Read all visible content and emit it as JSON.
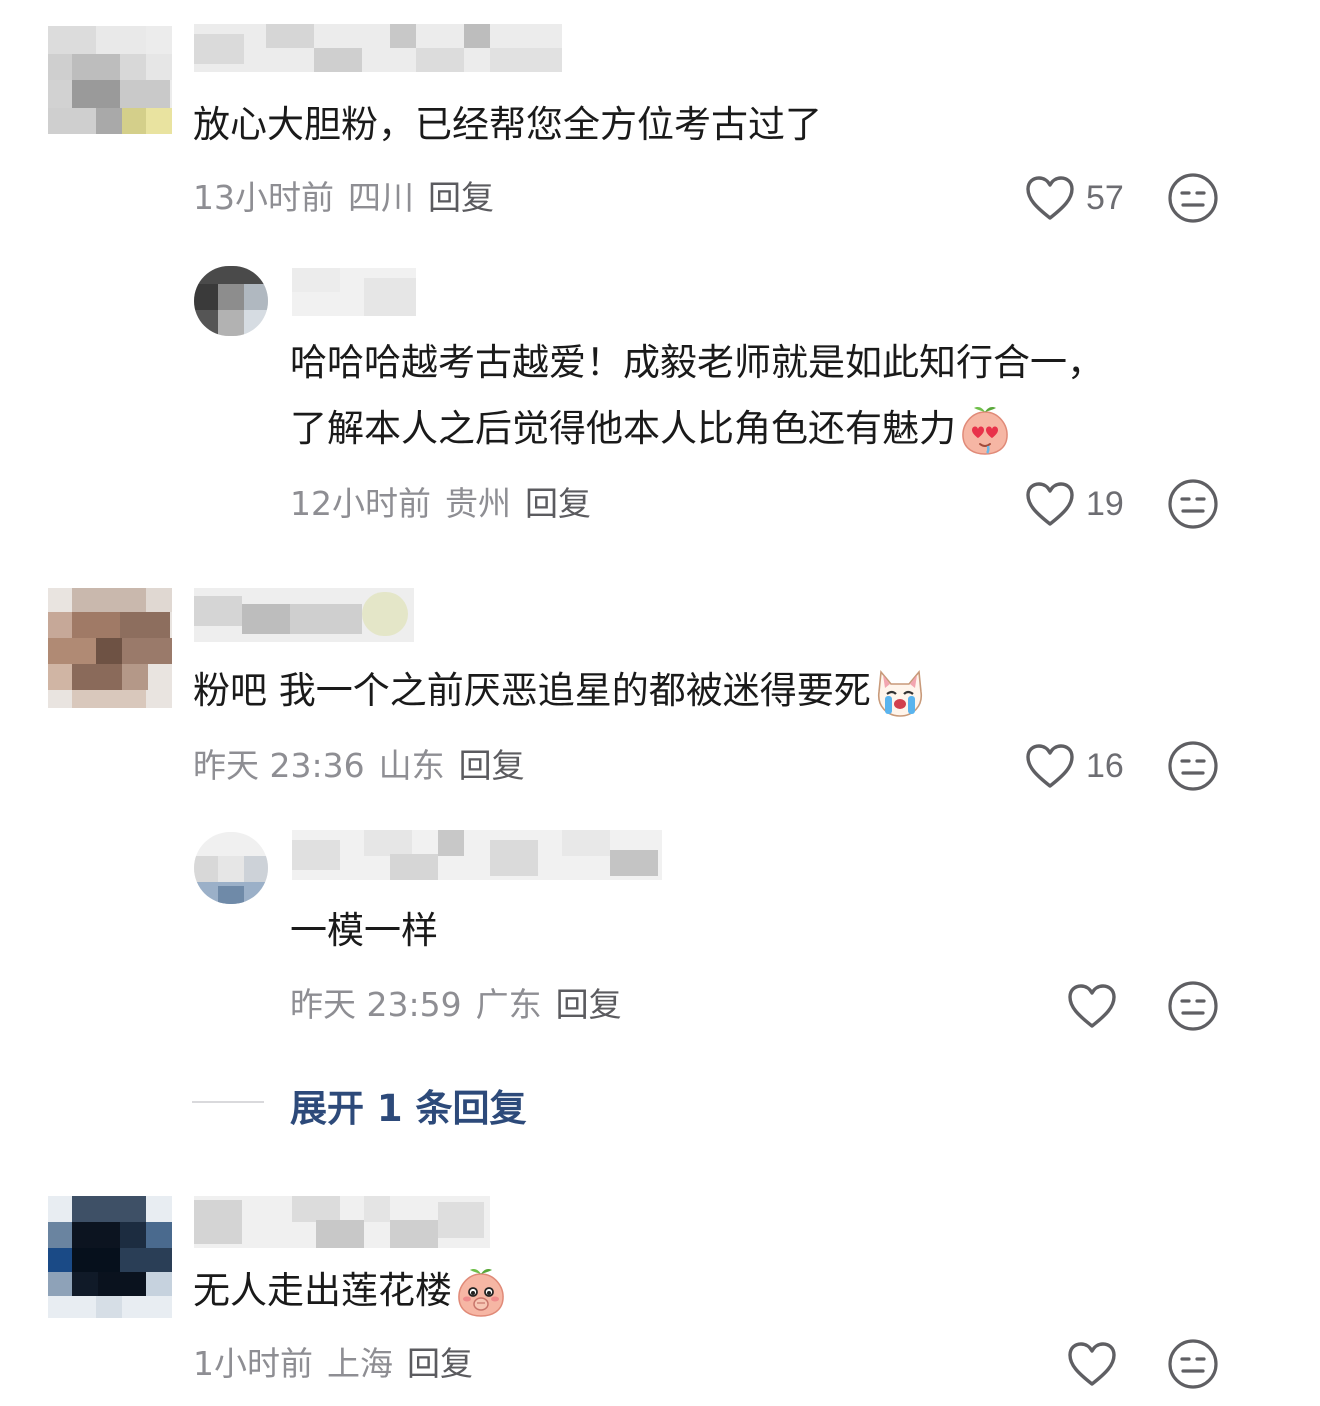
{
  "comments": [
    {
      "text": "放心大胆粉，已经帮您全方位考古过了",
      "time": "13小时前",
      "location": "四川",
      "reply_label": "回复",
      "likes": "57",
      "replies": [
        {
          "text_line1": "哈哈哈越考古越爱！成毅老师就是如此知行合一，",
          "text_line2": "了解本人之后觉得他本人比角色还有魅力",
          "emoji": "heart-eyes-peach-emoji",
          "time": "12小时前",
          "location": "贵州",
          "reply_label": "回复",
          "likes": "19"
        }
      ]
    },
    {
      "text": "粉吧 我一个之前厌恶追星的都被迷得要死",
      "emoji": "crying-dog-emoji",
      "time": "昨天 23:36",
      "location": "山东",
      "reply_label": "回复",
      "likes": "16",
      "replies": [
        {
          "text": "一模一样",
          "time": "昨天 23:59",
          "location": "广东",
          "reply_label": "回复",
          "likes": ""
        }
      ],
      "expand_label": "展开 1 条回复"
    },
    {
      "text": "无人走出莲花楼",
      "emoji": "shy-peach-emoji",
      "time": "1小时前",
      "location": "上海",
      "reply_label": "回复",
      "likes": ""
    }
  ],
  "icons": {
    "like": "heart-outline-icon",
    "dislike": "neutral-face-icon"
  },
  "colors": {
    "meta": "#8e8e93",
    "link": "#2d4a7a",
    "icon": "#5f5f63"
  }
}
